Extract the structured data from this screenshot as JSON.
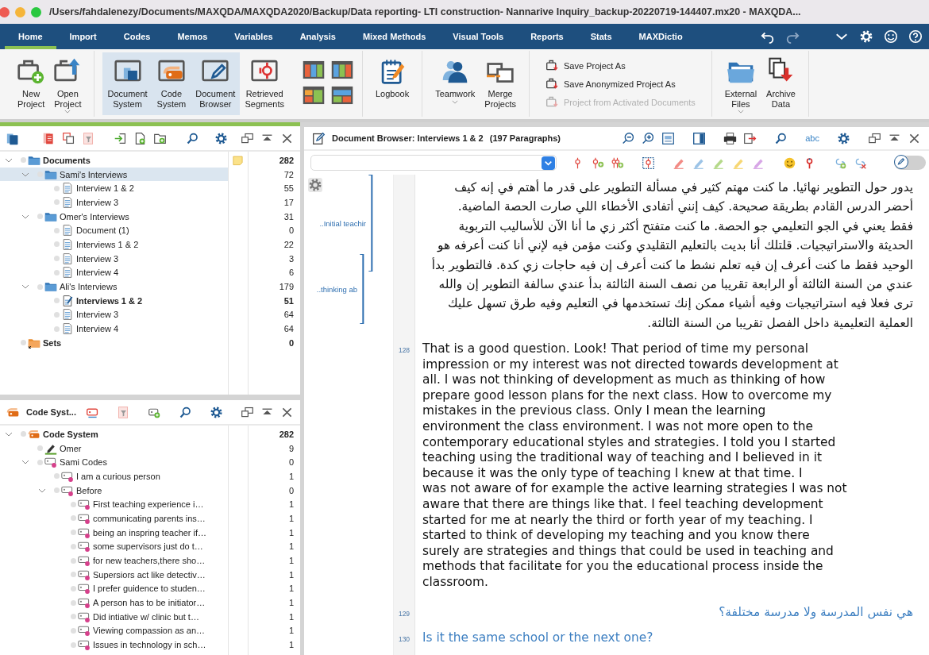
{
  "title_bar": {
    "title": "/Users/fahdalenezy/Documents/MAXQDA/MAXQDA2020/Backup/Data reporting- LTI construction- Nannarive Inquiry_backup-20220719-144407.mx20 - MAXQDA..."
  },
  "ribbon_tabs": [
    {
      "label": "Home",
      "selected": true
    },
    {
      "label": "Import",
      "selected": false
    },
    {
      "label": "Codes",
      "selected": false
    },
    {
      "label": "Memos",
      "selected": false
    },
    {
      "label": "Variables",
      "selected": false
    },
    {
      "label": "Analysis",
      "selected": false
    },
    {
      "label": "Mixed Methods",
      "selected": false
    },
    {
      "label": "Visual Tools",
      "selected": false
    },
    {
      "label": "Reports",
      "selected": false
    },
    {
      "label": "Stats",
      "selected": false
    },
    {
      "label": "MAXDictio",
      "selected": false
    }
  ],
  "ribbon": {
    "groups": [
      {
        "kind": "buttons",
        "buttons": [
          {
            "label": "New Project",
            "dropdown": false,
            "selected": false
          },
          {
            "label": "Open Project",
            "dropdown": true,
            "selected": false
          }
        ]
      },
      {
        "kind": "buttons",
        "layouts": true,
        "buttons": [
          {
            "label": "Document System",
            "dropdown": false,
            "selected": true
          },
          {
            "label": "Code System",
            "dropdown": false,
            "selected": true
          },
          {
            "label": "Document Browser",
            "dropdown": false,
            "selected": true
          },
          {
            "label": "Retrieved Segments",
            "dropdown": false,
            "selected": false
          }
        ]
      },
      {
        "kind": "buttons",
        "buttons": [
          {
            "label": "Logbook",
            "dropdown": false,
            "selected": false
          }
        ]
      },
      {
        "kind": "buttons",
        "buttons": [
          {
            "label": "Teamwork",
            "dropdown": true,
            "selected": false
          },
          {
            "label": "Merge Projects",
            "dropdown": false,
            "selected": false
          }
        ]
      },
      {
        "kind": "actions",
        "actions": [
          {
            "label": "Save Project As",
            "disabled": false
          },
          {
            "label": "Save Anonymized Project As",
            "disabled": false
          },
          {
            "label": "Project from Activated Documents",
            "disabled": true
          }
        ]
      },
      {
        "kind": "buttons",
        "buttons": [
          {
            "label": "External Files",
            "dropdown": true,
            "selected": false
          },
          {
            "label": "Archive Data",
            "dropdown": false,
            "selected": false
          }
        ]
      }
    ]
  },
  "document_system": {
    "rows": [
      {
        "label": "Documents",
        "kind": "folder",
        "count": "282",
        "memo": true,
        "selected": false,
        "expanded": true,
        "children": [
          {
            "label": "Sami's Interviews",
            "kind": "folder",
            "count": "72",
            "memo": false,
            "selected": true,
            "expanded": true,
            "children": [
              {
                "label": "Interview 1 & 2",
                "kind": "document",
                "count": "55",
                "memo": false,
                "selected": false,
                "open": false
              },
              {
                "label": "Interview 3",
                "kind": "document",
                "count": "17",
                "memo": false,
                "selected": false,
                "open": false
              }
            ]
          },
          {
            "label": "Omer's Interviews",
            "kind": "folder",
            "count": "31",
            "memo": false,
            "selected": false,
            "expanded": true,
            "children": [
              {
                "label": "Document (1)",
                "kind": "document",
                "count": "0",
                "memo": false,
                "selected": false,
                "open": false
              },
              {
                "label": "Interviews 1 & 2",
                "kind": "document",
                "count": "22",
                "memo": false,
                "selected": false,
                "open": false
              },
              {
                "label": "Interview 3",
                "kind": "document",
                "count": "3",
                "memo": false,
                "selected": false,
                "open": false
              },
              {
                "label": "Interview 4",
                "kind": "document",
                "count": "6",
                "memo": false,
                "selected": false,
                "open": false
              }
            ]
          },
          {
            "label": "Ali's Interviews",
            "kind": "folder",
            "count": "179",
            "memo": false,
            "selected": false,
            "expanded": true,
            "children": [
              {
                "label": "Interviews 1 & 2",
                "kind": "document",
                "count": "51",
                "memo": false,
                "selected": false,
                "open": true
              },
              {
                "label": "Interview 3",
                "kind": "document",
                "count": "64",
                "memo": false,
                "selected": false,
                "open": false
              },
              {
                "label": "Interview 4",
                "kind": "document",
                "count": "64",
                "memo": false,
                "selected": false,
                "open": false
              }
            ]
          }
        ]
      },
      {
        "label": "Sets",
        "kind": "set",
        "count": "0",
        "memo": false,
        "selected": false
      }
    ]
  },
  "code_system": {
    "title": "Code Syst...",
    "rows": [
      {
        "label": "Code System",
        "kind": "root",
        "count": "282",
        "selected": false,
        "expanded": true,
        "children": [
          {
            "label": "Omer",
            "kind": "highlight",
            "color": "#5aa02c",
            "count": "9",
            "selected": false
          },
          {
            "label": "Sami Codes",
            "kind": "code",
            "color": "#d6408b",
            "count": "0",
            "selected": false,
            "expanded": true,
            "children": [
              {
                "label": "I am a curious person",
                "kind": "code",
                "color": "#d6408b",
                "count": "1",
                "selected": false
              },
              {
                "label": "Before",
                "kind": "code",
                "color": "#d6408b",
                "count": "0",
                "selected": false,
                "expanded": true,
                "children": [
                  {
                    "label": "First teaching experience i…",
                    "kind": "code",
                    "color": "#d6408b",
                    "count": "1",
                    "selected": false
                  },
                  {
                    "label": "communicating parents ins…",
                    "kind": "code",
                    "color": "#d6408b",
                    "count": "1",
                    "selected": false
                  },
                  {
                    "label": "being an inspring teacher if…",
                    "kind": "code",
                    "color": "#d6408b",
                    "count": "1",
                    "selected": false
                  },
                  {
                    "label": "some supervisors just do t…",
                    "kind": "code",
                    "color": "#d6408b",
                    "count": "1",
                    "selected": false
                  },
                  {
                    "label": "for new teachers,there sho…",
                    "kind": "code",
                    "color": "#d6408b",
                    "count": "1",
                    "selected": false
                  },
                  {
                    "label": "Supersiors act like detectiv…",
                    "kind": "code",
                    "color": "#d6408b",
                    "count": "1",
                    "selected": false
                  },
                  {
                    "label": "I prefer guidence to studen…",
                    "kind": "code",
                    "color": "#d6408b",
                    "count": "1",
                    "selected": false
                  },
                  {
                    "label": "A person has to be initiator…",
                    "kind": "code",
                    "color": "#d6408b",
                    "count": "1",
                    "selected": false
                  },
                  {
                    "label": "Did  intiative w/ clinic but t…",
                    "kind": "code",
                    "color": "#d6408b",
                    "count": "1",
                    "selected": false
                  },
                  {
                    "label": "Viewing compassion as an…",
                    "kind": "code",
                    "color": "#d6408b",
                    "count": "1",
                    "selected": false
                  },
                  {
                    "label": "Issues in technology in sch…",
                    "kind": "code",
                    "color": "#d6408b",
                    "count": "1",
                    "selected": false
                  }
                ]
              }
            ]
          }
        ]
      }
    ]
  },
  "document_browser": {
    "title": "Document Browser: Interviews 1 & 2",
    "paragraph_count": "(197 Paragraphs)",
    "spellcheck": "abc",
    "edit_toggle": {
      "on": false
    },
    "coding_stripes": [
      {
        "label": "..Initial teachir"
      },
      {
        "label": "..thinking ab"
      }
    ],
    "paragraphs": [
      {
        "kind": "answer",
        "lines": [
          "يدور حول التطوير نهائيا. ما كنت مهتم كثير في مسألة التطوير على قدر ما أهتم في إنه كيف",
          "أحضر الدرس القادم بطريقة صحيحة. كيف إنني أتفادى الأخطاء اللي صارت الحصة الماضية.",
          "فقط يعني في الجو التعليمي جو الحصة. ما كنت متفتح أكثر زي ما أنا الآن للأساليب التربوية",
          "الحديثة والاستراتيجيات. قلتلك أنا بديت بالتعليم التقليدي وكنت مؤمن فيه لإني أنا كنت أعرفه هو",
          "الوحيد فقط ما كنت أعرف إن فيه تعلم نشط ما كنت أعرف إن فيه حاجات زي كدة. فالتطوير بدأ",
          "عندي من السنة الثالثة أو الرابعة تقريبا من نصف السنة الثالثة بدأ عندي سالفة التطوير إن والله",
          "ترى فعلا فيه استراتيجيات وفيه أشياء ممكن إنك تستخدمها في التعليم وفيه طرق تسهل عليك",
          "العملية التعليمية داخل الفصل تقريبا من السنة الثالثة."
        ]
      },
      {
        "number": "128",
        "kind": "answer",
        "lines": [
          "That is a good question. Look! That period of time my personal",
          "impression or my interest was not directed towards development at",
          "all. I was not thinking of development as much as thinking of how",
          "prepare good lesson plans for the next class. How to overcome my",
          "mistakes in the previous class. Only I mean the learning",
          "environment the class environment. I was not more open to the",
          "contemporary educational styles and strategies. I told you I started",
          "teaching using the traditional way of teaching and I believed in it",
          "because it was the only type of teaching I knew at that time. I",
          "was not aware of for example the active learning strategies I was not",
          "aware that there are things like that. I feel teaching development",
          "started for me at nearly the third or forth year of my teaching. I",
          "started to think of developing my teaching and you know there",
          "surely are strategies and things that could be used in teaching and",
          "methods that facilitate for you the educational process inside the",
          "classroom."
        ]
      },
      {
        "number": "129",
        "kind": "question",
        "lines": [
          "هي نفس المدرسة ولا مدرسة مختلفة؟"
        ]
      },
      {
        "number": "130",
        "kind": "question",
        "lines": [
          "Is it the same school or the next one?"
        ]
      }
    ]
  }
}
